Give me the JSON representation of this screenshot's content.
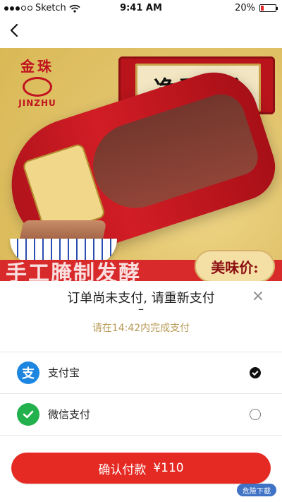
{
  "status_bar": {
    "carrier": "Sketch",
    "time": "9:41 AM",
    "battery_percent": "20%"
  },
  "nav": {
    "back_icon": "chevron-left-icon"
  },
  "banner": {
    "brand_cn": "金珠",
    "brand_en": "JINZHU",
    "headline": "净重2斤",
    "slogan": "手工腌制发酵",
    "taste_text": "美味价:",
    "watermark": "危險下載"
  },
  "payment": {
    "title": "订单尚未支付, 请重新支付",
    "dash": "–",
    "timer_text": "请在14:42内完成支付",
    "close_icon": "close-icon",
    "methods": [
      {
        "name": "支付宝",
        "icon": "alipay-icon",
        "selected": true
      },
      {
        "name": "微信支付",
        "icon": "wechat-pay-icon",
        "selected": false
      }
    ],
    "confirm_label": "确认付款",
    "amount": "¥110"
  },
  "colors": {
    "primary_red": "#e52a23",
    "timer_gold": "#b99a56",
    "alipay_blue": "#1c86e0",
    "wechat_green": "#22b14c"
  }
}
